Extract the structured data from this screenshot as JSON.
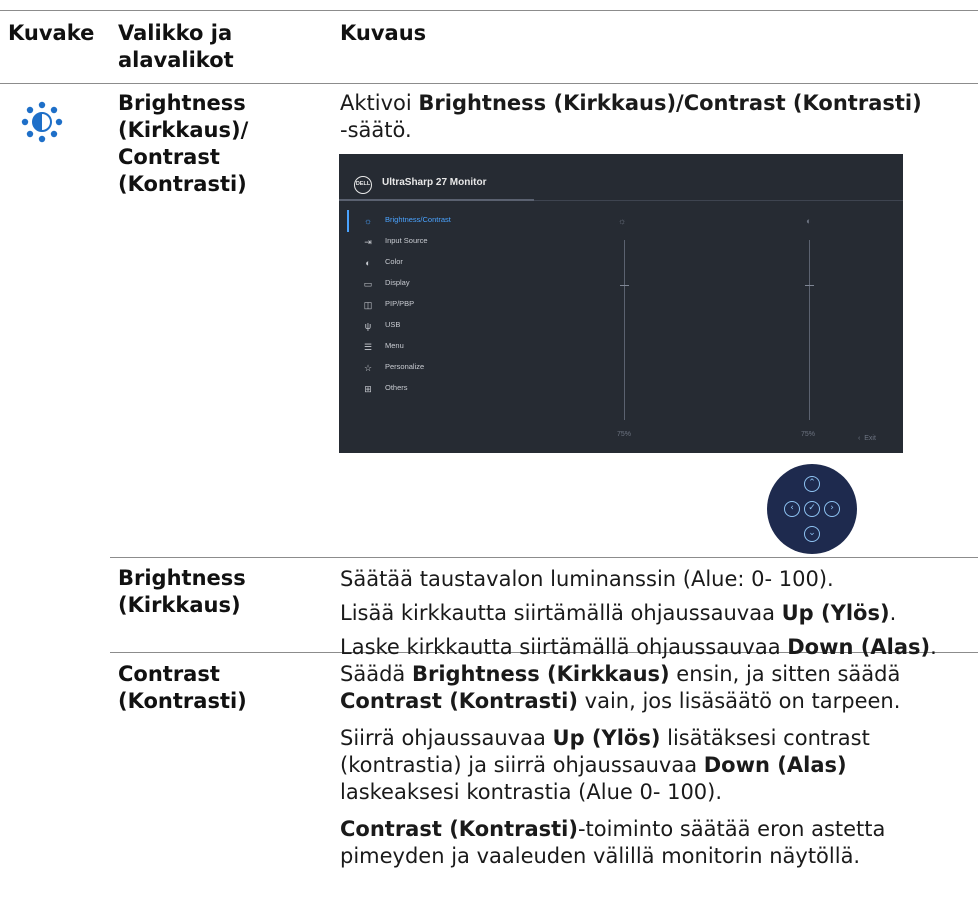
{
  "header": {
    "col1": "Kuvake",
    "col2_line1": "Valikko ja",
    "col2_line2": "alavalikot",
    "col3": "Kuvaus"
  },
  "row1": {
    "icon": "brightness-icon",
    "label": [
      "Brightness",
      "(Kirkkaus)/",
      "Contrast",
      "(Kontrasti)"
    ],
    "desc_prefix": "Aktivoi ",
    "desc_bold": "Brightness (Kirkkaus)/Contrast (Kontrasti)",
    "desc_suffix": "-säätö."
  },
  "osd": {
    "logo": "DELL",
    "title": "UltraSharp 27 Monitor",
    "menu_items": [
      {
        "label": "Brightness/Contrast",
        "icon": "sun-icon",
        "active": true
      },
      {
        "label": "Input Source",
        "icon": "input-icon"
      },
      {
        "label": "Color",
        "icon": "palette-icon"
      },
      {
        "label": "Display",
        "icon": "display-icon"
      },
      {
        "label": "PIP/PBP",
        "icon": "pip-icon"
      },
      {
        "label": "USB",
        "icon": "usb-icon"
      },
      {
        "label": "Menu",
        "icon": "menu-icon"
      },
      {
        "label": "Personalize",
        "icon": "star-icon"
      },
      {
        "label": "Others",
        "icon": "others-icon"
      }
    ],
    "brightness_value": "75%",
    "contrast_value": "75%",
    "exit_label": "Exit",
    "colors": {
      "background": "#262b33",
      "accent": "#4aa3ff"
    }
  },
  "row2": {
    "label": [
      "Brightness",
      "(Kirkkaus)"
    ],
    "p1": "Säätää taustavalon luminanssin (Alue: 0- 100).",
    "p2_prefix": "Lisää kirkkautta siirtämällä ohjaussauvaa ",
    "p2_bold": "Up (Ylös)",
    "p2_suffix": ".",
    "p3_prefix": "Laske kirkkautta siirtämällä ohjaussauvaa ",
    "p3_bold": "Down (Alas)",
    "p3_suffix": "."
  },
  "row3": {
    "label": [
      "Contrast",
      "(Kontrasti)"
    ],
    "p1_a": "Säädä ",
    "p1_b": "Brightness (Kirkkaus)",
    "p1_c": " ensin, ja sitten säädä",
    "p1_d": "Contrast (Kontrasti)",
    "p1_e": " vain, jos lisäsäätö on tarpeen.",
    "p2_a": "Siirrä ohjaussauvaa ",
    "p2_b": "Up (Ylös)",
    "p2_c": " lisätäksesi contrast",
    "p2_d": "(kontrastia) ja siirrä ohjaussauvaa ",
    "p2_e": "Down (Alas)",
    "p2_f": "laskeaksesi kontrastia (Alue 0- 100).",
    "p3_a": "Contrast (Kontrasti)",
    "p3_b": "-toiminto säätää eron astetta",
    "p3_c": "pimeyden ja vaaleuden välillä monitorin näytöllä."
  }
}
